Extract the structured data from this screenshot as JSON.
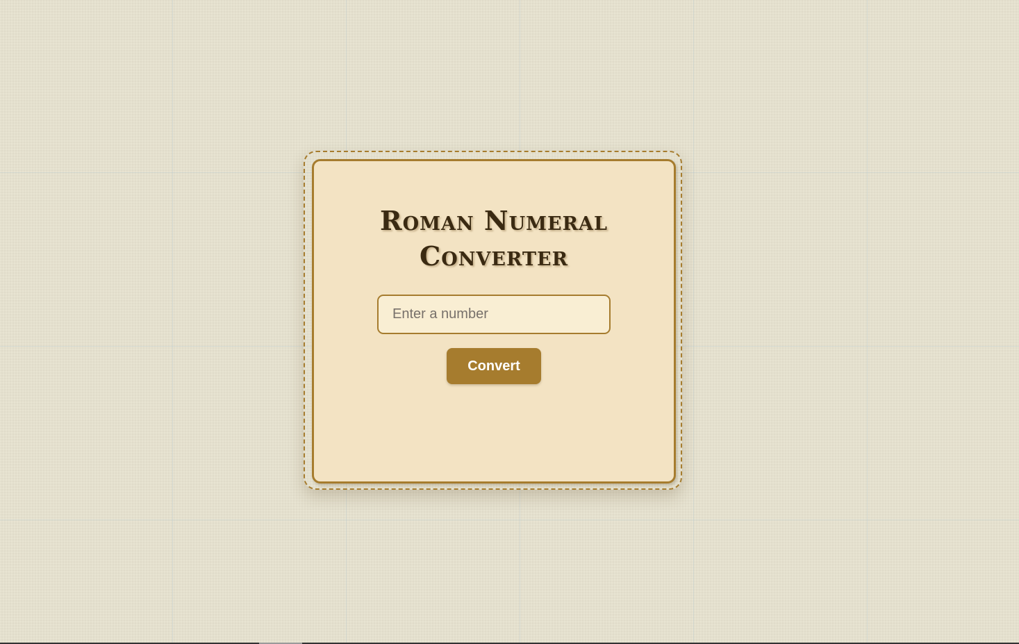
{
  "app": {
    "title": "Roman Numeral Converter"
  },
  "converter": {
    "input": {
      "value": "",
      "placeholder": "Enter a number"
    },
    "convert_label": "Convert",
    "result": ""
  },
  "colors": {
    "background": "#e6e1cd",
    "card_background": "#f3e3c3",
    "accent": "#a67c2e",
    "title_text": "#3a2a12"
  }
}
